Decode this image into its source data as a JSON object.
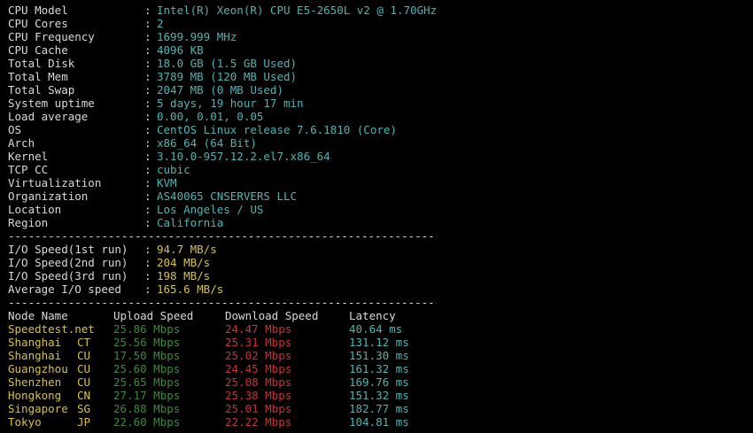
{
  "system_info": [
    {
      "key": "CPU Model",
      "value": "Intel(R) Xeon(R) CPU E5-2650L v2 @ 1.70GHz"
    },
    {
      "key": "CPU Cores",
      "value": "2"
    },
    {
      "key": "CPU Frequency",
      "value": "1699.999 MHz"
    },
    {
      "key": "CPU Cache",
      "value": "4096 KB"
    },
    {
      "key": "Total Disk",
      "value": "18.0 GB (1.5 GB Used)"
    },
    {
      "key": "Total Mem",
      "value": "3789 MB (120 MB Used)"
    },
    {
      "key": "Total Swap",
      "value": "2047 MB (0 MB Used)"
    },
    {
      "key": "System uptime",
      "value": "5 days, 19 hour 17 min"
    },
    {
      "key": "Load average",
      "value": "0.00, 0.01, 0.05"
    },
    {
      "key": "OS",
      "value": "CentOS Linux release 7.6.1810 (Core)"
    },
    {
      "key": "Arch",
      "value": "x86_64 (64 Bit)"
    },
    {
      "key": "Kernel",
      "value": "3.10.0-957.12.2.el7.x86_64"
    },
    {
      "key": "TCP CC",
      "value": "cubic"
    },
    {
      "key": "Virtualization",
      "value": "KVM"
    },
    {
      "key": "Organization",
      "value": "AS40065 CNSERVERS LLC"
    },
    {
      "key": "Location",
      "value": "Los Angeles / US"
    },
    {
      "key": "Region",
      "value": "California"
    }
  ],
  "separator_char": ":",
  "divider_line": "----------------------------------------------------------------------",
  "io_speed": [
    {
      "key": "I/O Speed(1st run)",
      "value": "94.7 MB/s"
    },
    {
      "key": "I/O Speed(2nd run)",
      "value": "204 MB/s"
    },
    {
      "key": "I/O Speed(3rd run)",
      "value": "198 MB/s"
    },
    {
      "key": "Average I/O speed",
      "value": "165.6 MB/s"
    }
  ],
  "speedtest": {
    "headers": {
      "node_name": "Node Name",
      "upload": "Upload Speed",
      "download": "Download Speed",
      "latency": "Latency"
    },
    "rows": [
      {
        "name": "Speedtest.net",
        "code": "",
        "upload": "25.86 Mbps",
        "download": "24.47 Mbps",
        "latency": "40.64 ms"
      },
      {
        "name": "Shanghai",
        "code": "CT",
        "upload": "25.56 Mbps",
        "download": "25.31 Mbps",
        "latency": "131.12 ms"
      },
      {
        "name": "Shanghai",
        "code": "CU",
        "upload": "17.50 Mbps",
        "download": "25.02 Mbps",
        "latency": "151.30 ms"
      },
      {
        "name": "Guangzhou",
        "code": "CU",
        "upload": "25.60 Mbps",
        "download": "24.45 Mbps",
        "latency": "161.32 ms"
      },
      {
        "name": "Shenzhen",
        "code": "CU",
        "upload": "25.65 Mbps",
        "download": "25.08 Mbps",
        "latency": "169.76 ms"
      },
      {
        "name": "Hongkong",
        "code": "CN",
        "upload": "27.17 Mbps",
        "download": "25.38 Mbps",
        "latency": "151.32 ms"
      },
      {
        "name": "Singapore",
        "code": "SG",
        "upload": "26.88 Mbps",
        "download": "25.01 Mbps",
        "latency": "182.77 ms"
      },
      {
        "name": "Tokyo",
        "code": "JP",
        "upload": "22.60 Mbps",
        "download": "22.22 Mbps",
        "latency": "104.81 ms"
      }
    ]
  },
  "colors": {
    "background": "#000000",
    "label": "#d9d9d9",
    "system_value": "#4fb5b5",
    "io_value": "#d8c244",
    "node_name": "#d8c244",
    "upload": "#3c8a3c",
    "download": "#c43535",
    "latency": "#4fb5b5"
  }
}
